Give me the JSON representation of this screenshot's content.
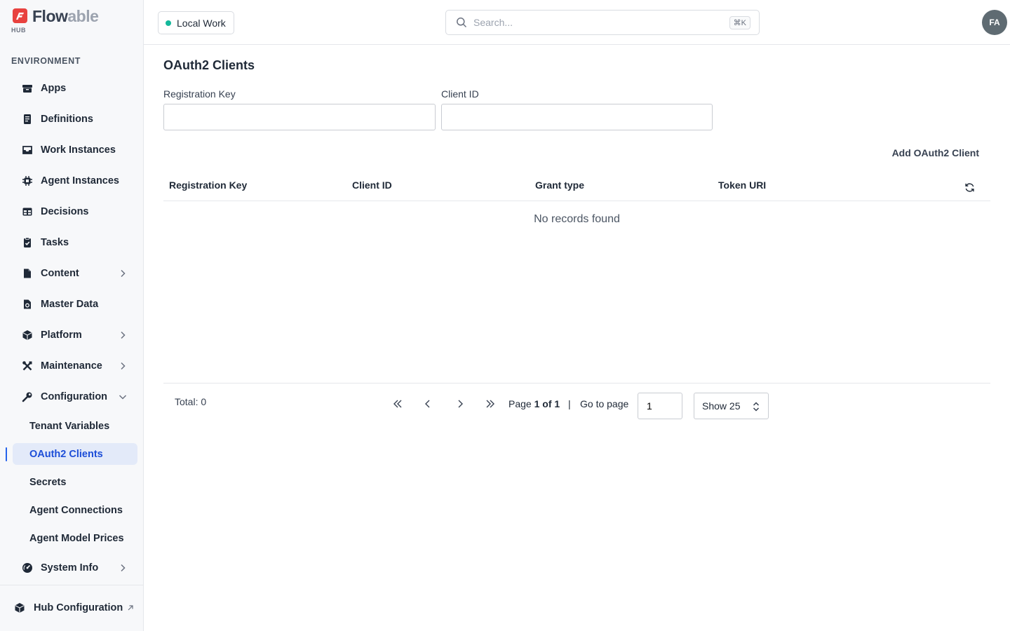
{
  "brand": {
    "name_dark": "Flow",
    "name_light": "able",
    "sub": "HUB"
  },
  "sidebar": {
    "section_label": "ENVIRONMENT",
    "items": [
      {
        "label": "Apps",
        "icon": "box-icon"
      },
      {
        "label": "Definitions",
        "icon": "document-icon"
      },
      {
        "label": "Work Instances",
        "icon": "inbox-icon"
      },
      {
        "label": "Agent Instances",
        "icon": "chip-icon"
      },
      {
        "label": "Decisions",
        "icon": "table-icon"
      },
      {
        "label": "Tasks",
        "icon": "clipboard-check-icon"
      },
      {
        "label": "Content",
        "icon": "file-icon",
        "chevron": "right"
      },
      {
        "label": "Master Data",
        "icon": "file-data-icon"
      },
      {
        "label": "Platform",
        "icon": "cube-icon",
        "chevron": "right"
      },
      {
        "label": "Maintenance",
        "icon": "tools-icon",
        "chevron": "right"
      },
      {
        "label": "Configuration",
        "icon": "wrench-icon",
        "chevron": "down"
      }
    ],
    "sub_items": [
      {
        "label": "Tenant Variables"
      },
      {
        "label": "OAuth2 Clients",
        "active": true
      },
      {
        "label": "Secrets"
      },
      {
        "label": "Agent Connections"
      },
      {
        "label": "Agent Model Prices"
      }
    ],
    "system_info": {
      "label": "System Info",
      "icon": "gauge-icon"
    },
    "footer": {
      "label": "Hub Configuration",
      "icon": "cube-icon"
    },
    "accent_color": "#2563eb",
    "active_bg": "#e3eaf9"
  },
  "header": {
    "environment": "Local Work",
    "environment_status_color": "#14b89b",
    "search_placeholder": "Search...",
    "search_shortcut": "⌘K",
    "avatar_initials": "FA"
  },
  "main": {
    "title": "OAuth2 Clients",
    "filters": [
      {
        "label": "Registration Key",
        "value": ""
      },
      {
        "label": "Client ID",
        "value": ""
      }
    ],
    "add_button": "Add OAuth2 Client",
    "table": {
      "columns": [
        "Registration Key",
        "Client ID",
        "Grant type",
        "Token URI"
      ],
      "rows": [],
      "empty_text": "No records found"
    },
    "pagination": {
      "total": "Total: 0",
      "page_prefix": "Page",
      "page_current": "1 of 1",
      "separator": "|",
      "goto_label": "Go to page",
      "goto_value": "1",
      "page_size": "Show 25"
    }
  }
}
